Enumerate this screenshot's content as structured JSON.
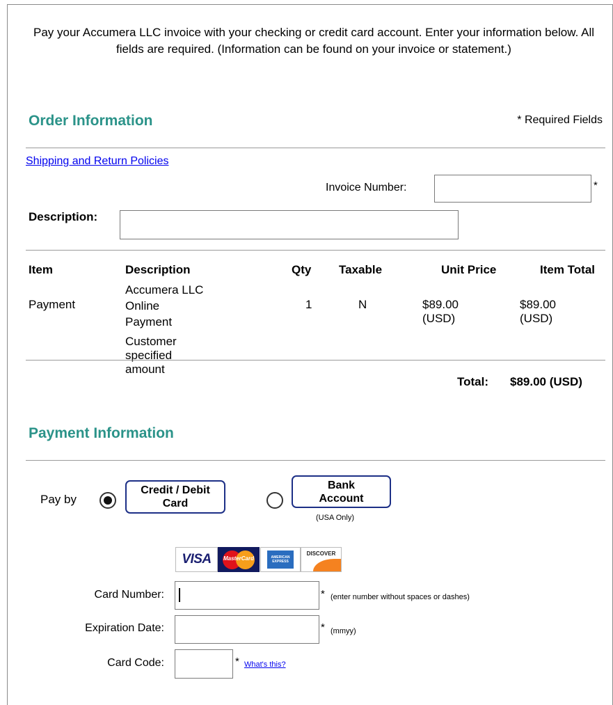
{
  "intro": {
    "text": "Pay your Accumera LLC invoice with your checking or credit card account. Enter your information below. All fields are required. (Information can be found on your invoice or statement.)"
  },
  "order": {
    "title": "Order Information",
    "required_note": "* Required Fields",
    "policies_link": "Shipping and Return Policies",
    "invoice_label": "Invoice Number:",
    "invoice_value": "",
    "star": "*",
    "description_label": "Description:",
    "description_value": ""
  },
  "items_table": {
    "headers": {
      "item": "Item",
      "description": "Description",
      "qty": "Qty",
      "taxable": "Taxable",
      "unit_price": "Unit Price",
      "item_total": "Item Total"
    },
    "row": {
      "item": "Payment",
      "desc_line1": "Accumera LLC",
      "desc_line2": "Online",
      "desc_line3": "Payment",
      "qty": "1",
      "taxable": "N",
      "unit_price": "$89.00 (USD)",
      "item_total": "$89.00 (USD)",
      "note": "Customer specified amount"
    },
    "total_label": "Total:",
    "total_value": "$89.00 (USD)"
  },
  "payment": {
    "title": "Payment Information",
    "pay_by_label": "Pay by",
    "selected_method": "credit-card",
    "credit_button_line1": "Credit / Debit",
    "credit_button_line2": "Card",
    "bank_button_line1": "Bank",
    "bank_button_line2": "Account",
    "bank_note": "(USA Only)",
    "card_logos": {
      "visa": "VISA",
      "mastercard": "MasterCard",
      "amex": "AMERICAN EXPRESS",
      "discover": "DISCOVER"
    },
    "card_number_label": "Card Number:",
    "card_number_value": "",
    "card_number_hint": "(enter number without spaces or dashes)",
    "expiration_label": "Expiration Date:",
    "expiration_value": "",
    "expiration_hint": "(mmyy)",
    "card_code_label": "Card Code:",
    "card_code_value": "",
    "whats_this_link": "What's this?"
  },
  "colors": {
    "section_title": "#2b9389",
    "button_border": "#1c2f86",
    "link": "#0000ee"
  }
}
